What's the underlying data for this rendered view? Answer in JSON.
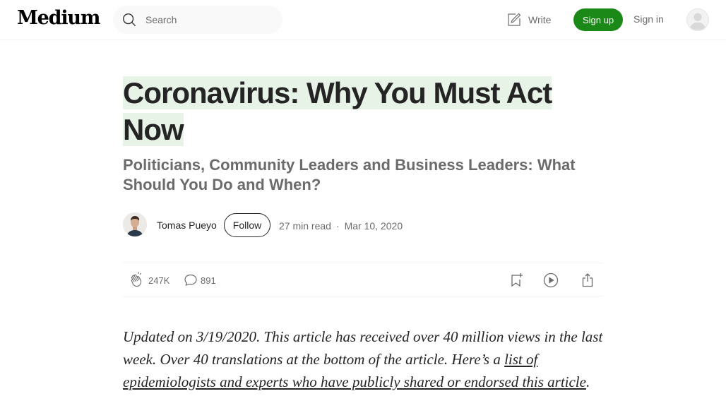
{
  "header": {
    "logo": "Medium",
    "search_placeholder": "Search",
    "write_label": "Write",
    "signup_label": "Sign up",
    "signin_label": "Sign in"
  },
  "article": {
    "title_line1": "Coronavirus: Why You Must Act",
    "title_line2": "Now",
    "subtitle": "Politicians, Community Leaders and Business Leaders: What Should You Do and When?",
    "author": "Tomas Pueyo",
    "follow_label": "Follow",
    "read_time": "27 min read",
    "separator": "·",
    "date": "Mar 10, 2020",
    "claps": "247K",
    "responses": "891",
    "body": {
      "text_before": "Updated on 3/19/2020. This article has received over 40 million views in the last week. Over 40 translations at the bottom of the article. Here’s a ",
      "link": "list of epidemiologists and experts who have publicly shared or endorsed this article",
      "text_after": "."
    }
  },
  "colors": {
    "accent_green": "#1a8917",
    "title_highlight": "#e8f3e8",
    "muted_text": "#6b6b6b",
    "text": "#242424"
  },
  "icons": [
    "search-icon",
    "write-icon",
    "user-avatar-icon",
    "clap-icon",
    "comment-icon",
    "bookmark-add-icon",
    "play-icon",
    "share-icon"
  ]
}
